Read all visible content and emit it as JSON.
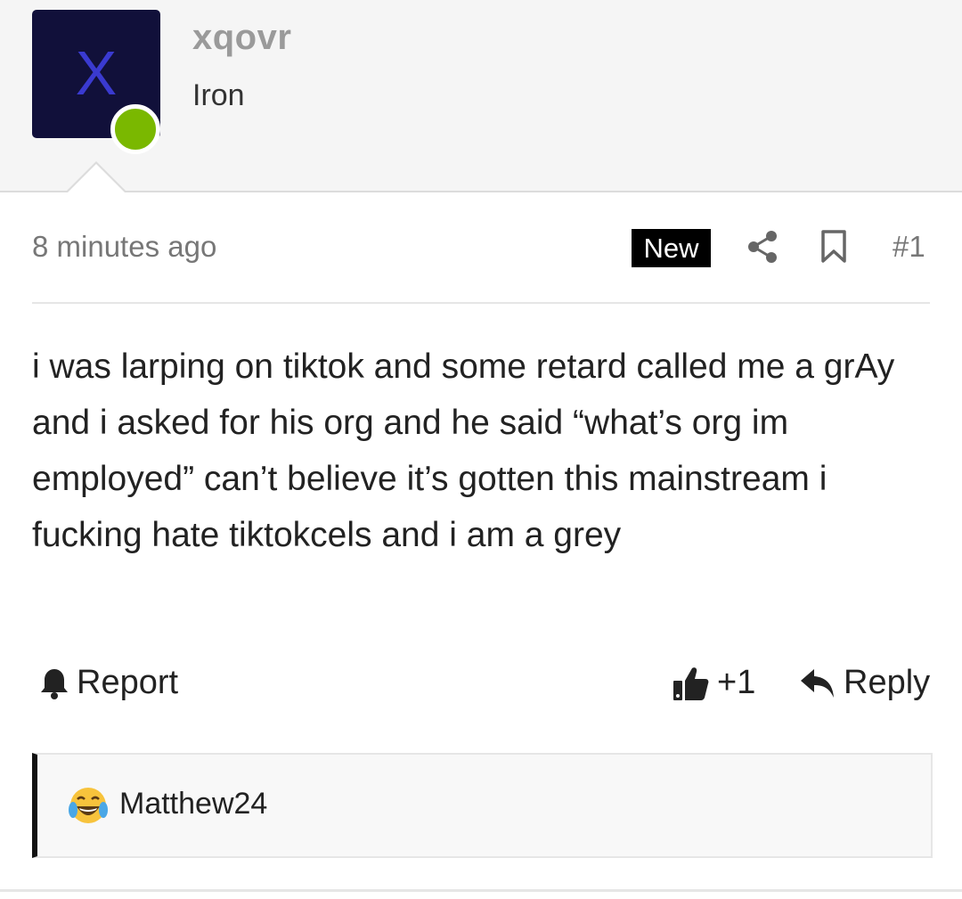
{
  "user": {
    "avatar_letter": "X",
    "avatar_bg": "#11103a",
    "avatar_letter_color": "#3a3ad0",
    "online_status_color": "#7ab800",
    "username": "xqovr",
    "rank": "Iron"
  },
  "post": {
    "timestamp": "8 minutes ago",
    "badge": "New",
    "number": "#1",
    "body": "i was larping on tiktok and some retard called me a grAy and i asked for his org and he said “what’s org im employed” can’t believe it’s gotten this mainstream i fucking hate tiktokcels and i am a grey",
    "icons": [
      "share-icon",
      "bookmark-icon"
    ]
  },
  "actions": {
    "report_label": "Report",
    "like_count": "+1",
    "reply_label": "Reply",
    "icons": [
      "bell-icon",
      "thumbs-up-icon",
      "reply-arrow-icon"
    ]
  },
  "reactions": {
    "emoji": "face-with-tears-of-joy",
    "user": "Matthew24"
  }
}
